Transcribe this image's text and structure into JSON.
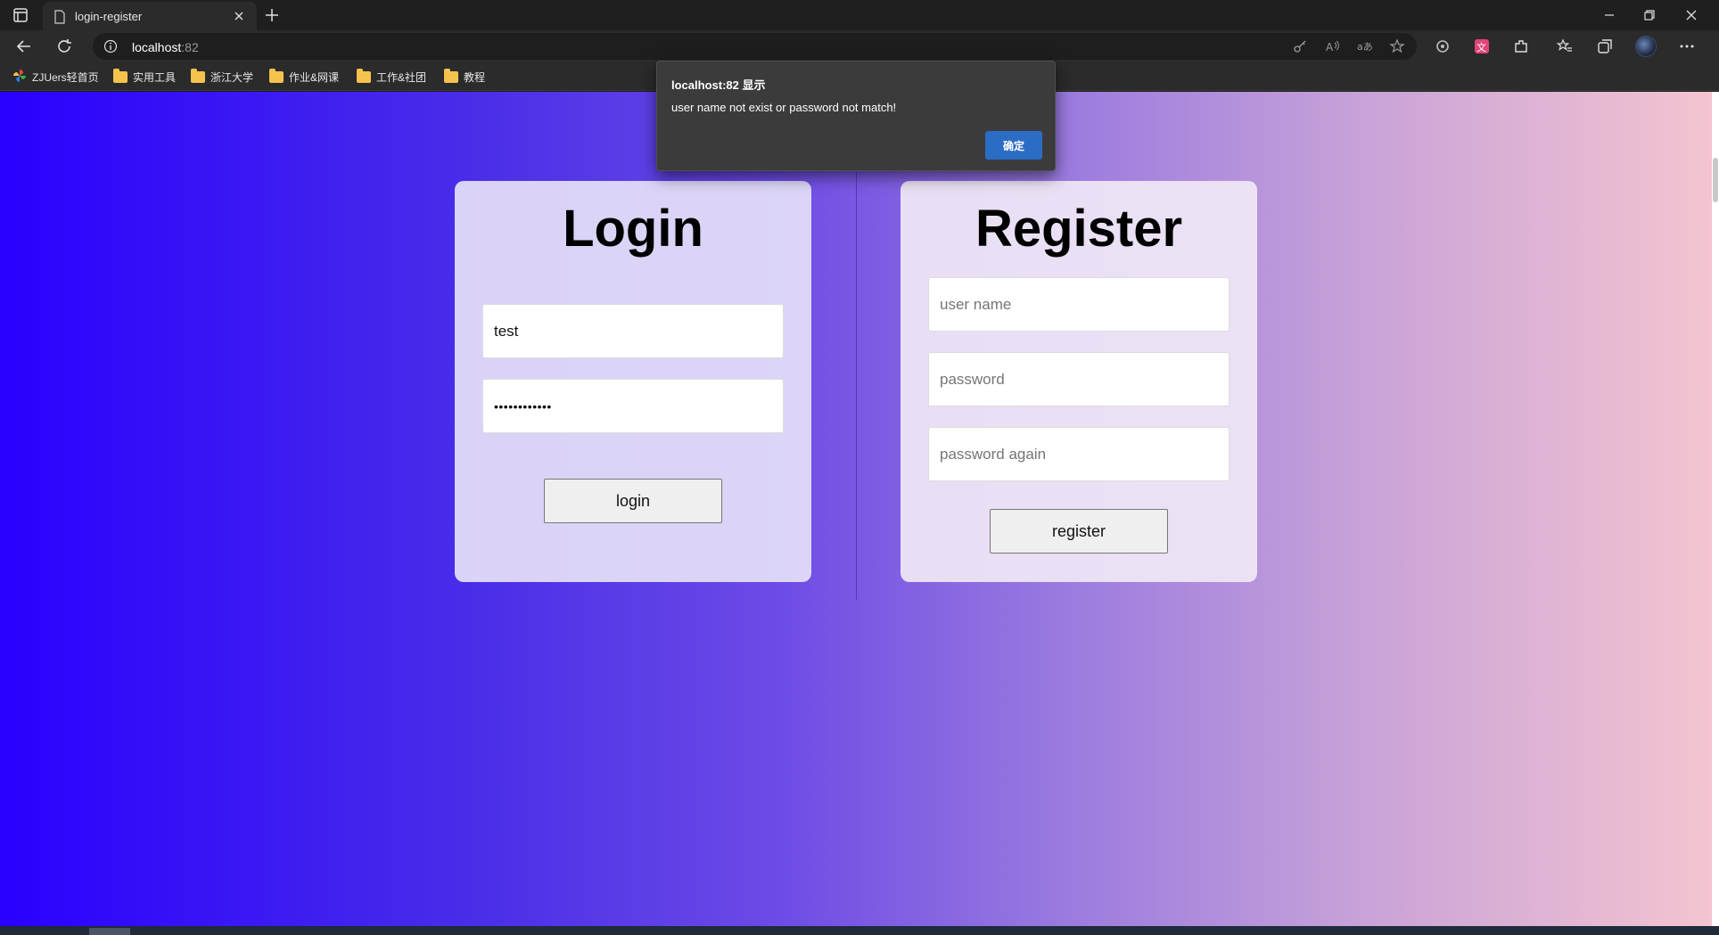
{
  "browser": {
    "tab": {
      "title": "login-register"
    },
    "address": {
      "host": "localhost",
      "port": ":82"
    },
    "bookmarks": [
      "ZJUers轻首页",
      "实用工具",
      "浙江大学",
      "作业&网课",
      "工作&社团",
      "教程"
    ]
  },
  "dialog": {
    "title": "localhost:82 显示",
    "message": "user name not exist or password not match!",
    "ok_label": "确定"
  },
  "login": {
    "heading": "Login",
    "username_value": "test",
    "password_value": "••••••••••••",
    "button_label": "login"
  },
  "register": {
    "heading": "Register",
    "username_placeholder": "user name",
    "password_placeholder": "password",
    "password_again_placeholder": "password again",
    "button_label": "register"
  },
  "colors": {
    "gradient_start": "#2a00ff",
    "gradient_end": "#f4c4d0",
    "dialog_bg": "#3b3b3b",
    "dialog_button": "#2b6cc4"
  }
}
